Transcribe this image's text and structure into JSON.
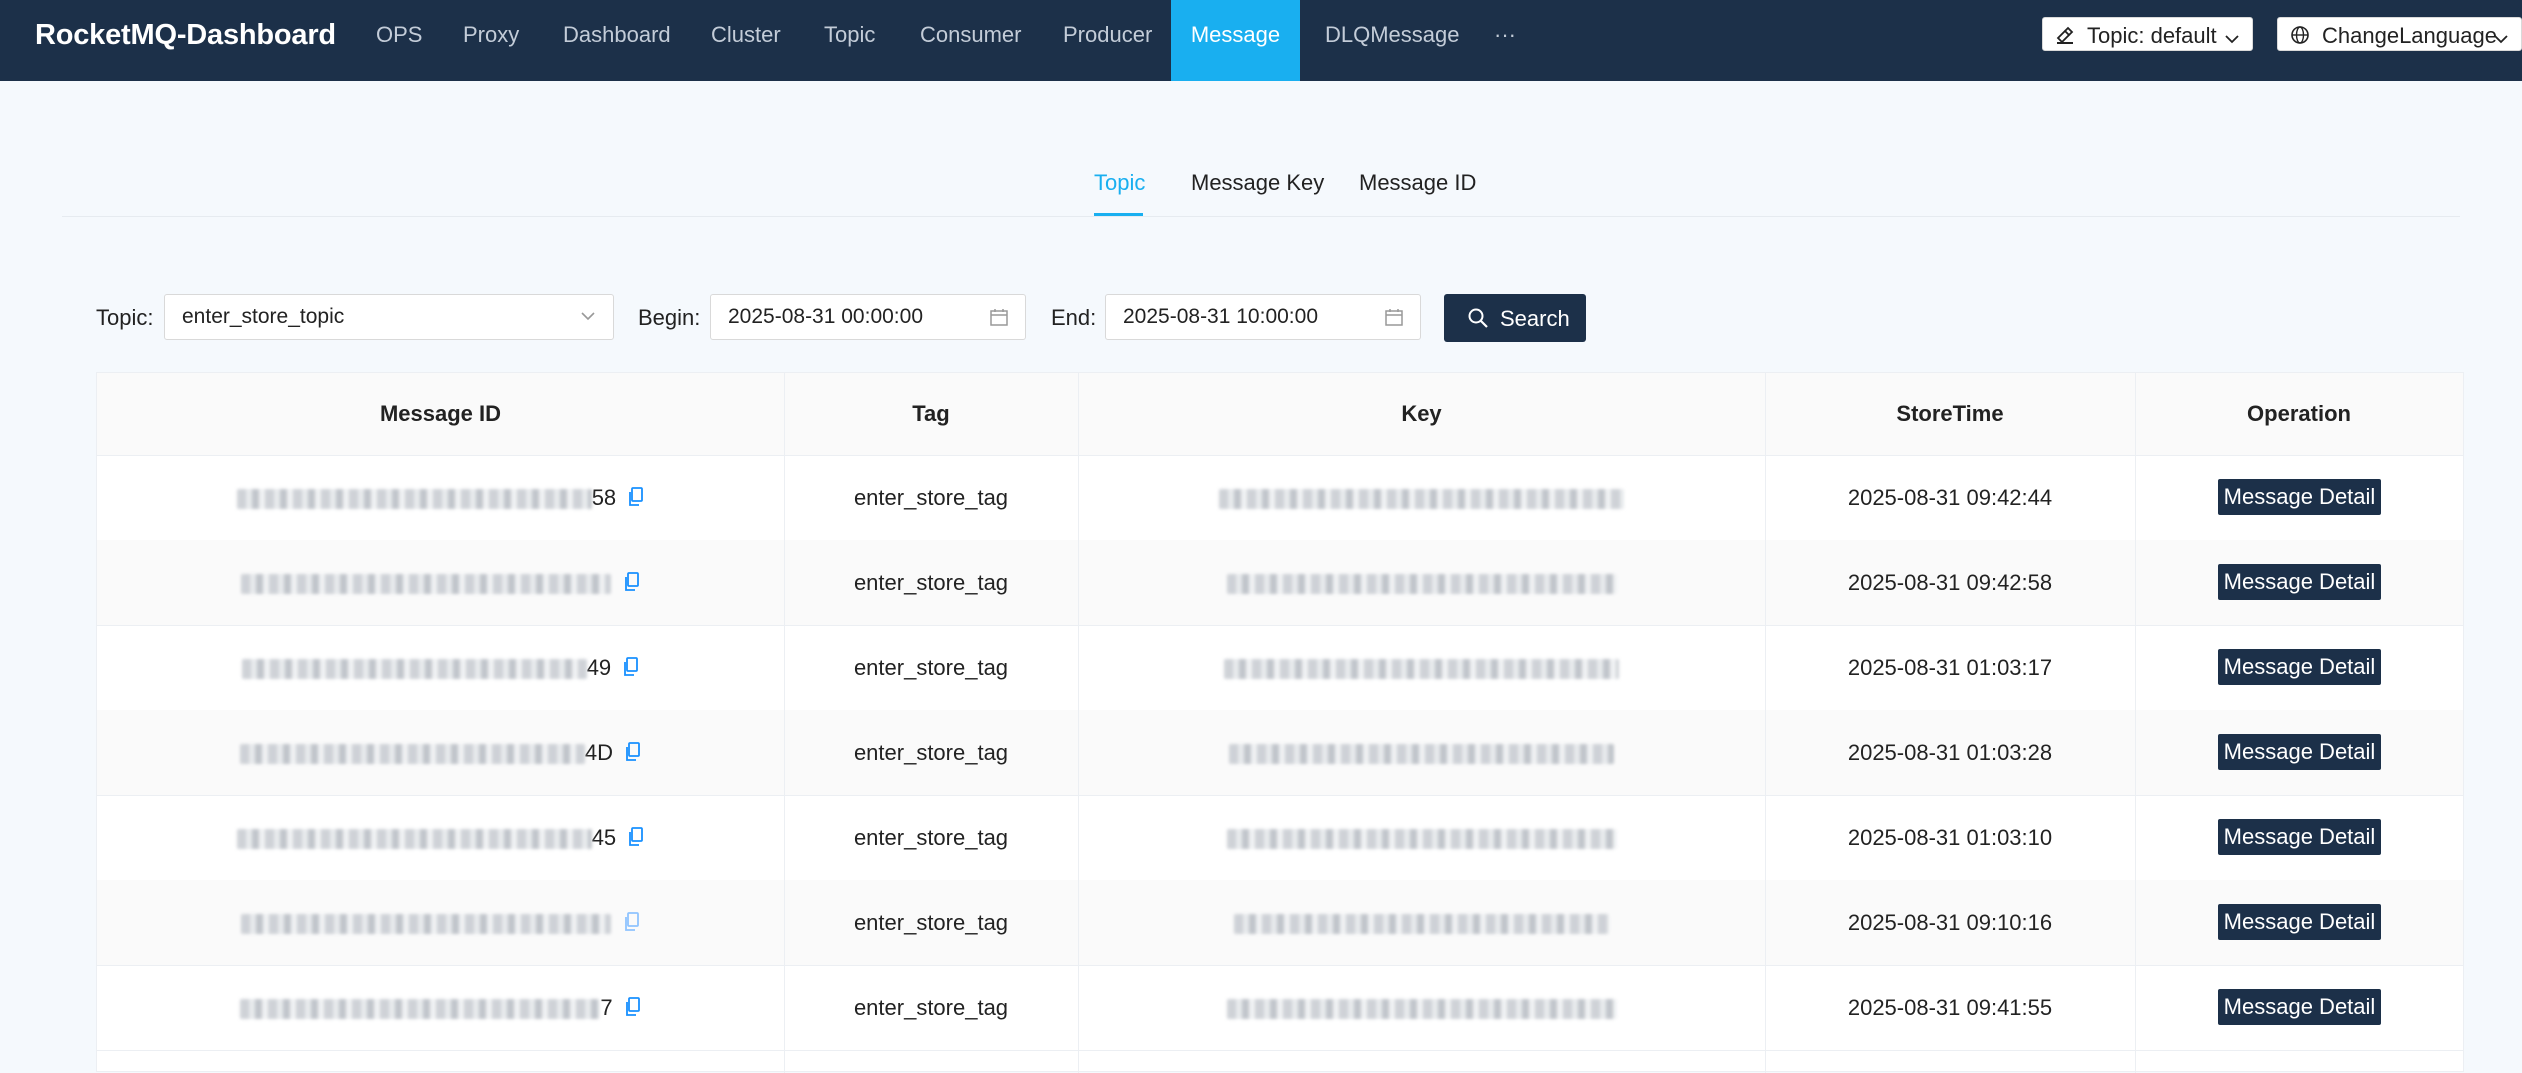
{
  "header": {
    "brand": "RocketMQ-Dashboard",
    "nav": [
      "OPS",
      "Proxy",
      "Dashboard",
      "Cluster",
      "Topic",
      "Consumer",
      "Producer",
      "Message",
      "DLQMessage",
      "···"
    ],
    "active_nav": "Message",
    "topic_select": "Topic: default",
    "language_select": "ChangeLanguage"
  },
  "tabs": [
    "Topic",
    "Message Key",
    "Message ID"
  ],
  "active_tab": "Topic",
  "search": {
    "topic_label": "Topic",
    "topic_value": "enter_store_topic",
    "begin_label": "Begin",
    "begin_value": "2025-08-31 00:00:00",
    "end_label": "End",
    "end_value": "2025-08-31 10:00:00",
    "button_label": "Search"
  },
  "table": {
    "columns": [
      "Message ID",
      "Tag",
      "Key",
      "StoreTime",
      "Operation"
    ],
    "rows": [
      {
        "message_id_suffix": "58",
        "tag": "enter_store_tag",
        "store_time": "2025-08-31 09:42:44",
        "action": "Message Detail"
      },
      {
        "message_id_suffix": "",
        "tag": "enter_store_tag",
        "store_time": "2025-08-31 09:42:58",
        "action": "Message Detail"
      },
      {
        "message_id_suffix": "49",
        "tag": "enter_store_tag",
        "store_time": "2025-08-31 01:03:17",
        "action": "Message Detail"
      },
      {
        "message_id_suffix": "4D",
        "tag": "enter_store_tag",
        "store_time": "2025-08-31 01:03:28",
        "action": "Message Detail"
      },
      {
        "message_id_suffix": "45",
        "tag": "enter_store_tag",
        "store_time": "2025-08-31 01:03:10",
        "action": "Message Detail"
      },
      {
        "message_id_suffix": "",
        "tag": "enter_store_tag",
        "store_time": "2025-08-31 09:10:16",
        "action": "Message Detail"
      },
      {
        "message_id_suffix": "7",
        "tag": "enter_store_tag",
        "store_time": "2025-08-31 09:41:55",
        "action": "Message Detail"
      }
    ]
  },
  "colors": {
    "header_bg": "#1c3049",
    "accent": "#19aff0",
    "button_bg": "#1c3049",
    "page_bg": "#f5f9fd"
  },
  "icons": [
    "format-painter-icon",
    "chevron-down-icon",
    "globe-icon",
    "calendar-icon",
    "search-icon",
    "copy-icon"
  ]
}
